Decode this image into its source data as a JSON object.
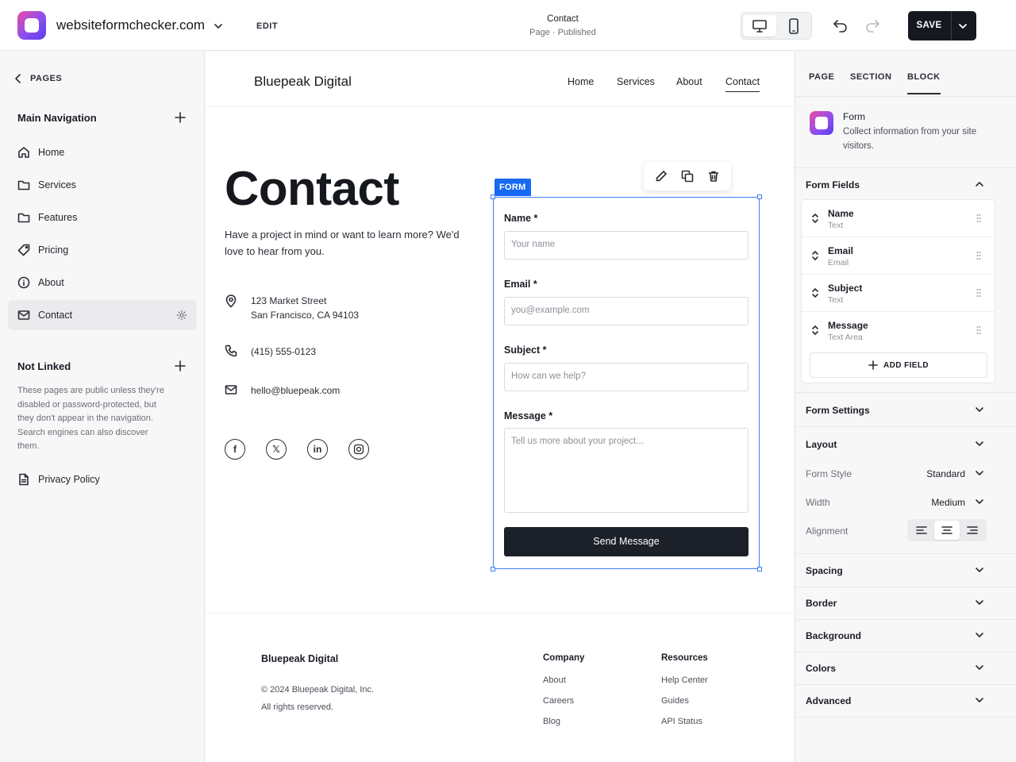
{
  "topbar": {
    "site_name": "websiteformchecker.com",
    "edit_label": "EDIT",
    "page_title": "Contact",
    "page_status": "Page · Published",
    "save_label": "SAVE",
    "active_device": "desktop"
  },
  "sidebar": {
    "back_label": "PAGES",
    "main_nav_title": "Main Navigation",
    "main_nav_items": [
      {
        "label": "Home",
        "icon": "home-icon"
      },
      {
        "label": "Services",
        "icon": "folder-icon"
      },
      {
        "label": "Features",
        "icon": "folder-icon"
      },
      {
        "label": "Pricing",
        "icon": "tag-icon"
      },
      {
        "label": "About",
        "icon": "info-icon"
      },
      {
        "label": "Contact",
        "icon": "mail-icon",
        "active": true
      }
    ],
    "not_linked_title": "Not Linked",
    "not_linked_note": "These pages are public unless they're disabled or password-protected, but they don't appear in the navigation. Search engines can also discover them.",
    "not_linked_items": [
      {
        "label": "Privacy Policy",
        "icon": "document-icon"
      }
    ]
  },
  "site": {
    "brand": "Bluepeak Digital",
    "nav": [
      "Home",
      "Services",
      "About",
      "Contact"
    ],
    "current_nav": "Contact",
    "hero_title": "Contact",
    "hero_text": "Have a project in mind or want to learn more? We'd love to hear from you.",
    "address_line1": "123 Market Street",
    "address_line2": "San Francisco, CA 94103",
    "phone": "(415) 555-0123",
    "email": "hello@bluepeak.com",
    "socials": [
      "facebook-icon",
      "x-icon",
      "linkedin-icon",
      "instagram-icon"
    ]
  },
  "form": {
    "tag": "FORM",
    "fields": [
      {
        "label": "Name *",
        "placeholder": "Your name"
      },
      {
        "label": "Email *",
        "placeholder": "you@example.com"
      },
      {
        "label": "Subject *",
        "placeholder": "How can we help?"
      },
      {
        "label": "Message *",
        "placeholder": "Tell us more about your project..."
      }
    ],
    "submit_label": "Send Message"
  },
  "footer": {
    "brand": "Bluepeak Digital",
    "copyright": "© 2024 Bluepeak Digital, Inc.",
    "rights": "All rights reserved.",
    "company_title": "Company",
    "company_links": [
      "About",
      "Careers",
      "Blog"
    ],
    "resources_title": "Resources",
    "resources_links": [
      "Help Center",
      "Guides",
      "API Status"
    ]
  },
  "panel": {
    "tabs": [
      "PAGE",
      "SECTION",
      "BLOCK"
    ],
    "active_tab": "BLOCK",
    "block_name": "Form",
    "block_desc": "Collect information from your site visitors.",
    "form_fields_title": "Form Fields",
    "form_fields": [
      {
        "name": "Name",
        "type": "Text"
      },
      {
        "name": "Email",
        "type": "Email"
      },
      {
        "name": "Subject",
        "type": "Text"
      },
      {
        "name": "Message",
        "type": "Text Area"
      }
    ],
    "add_field_label": "ADD FIELD",
    "form_settings_title": "Form Settings",
    "layout_title": "Layout",
    "form_style_label": "Form Style",
    "form_style_value": "Standard",
    "width_label": "Width",
    "width_value": "Medium",
    "alignment_label": "Alignment",
    "alignment_value": "center",
    "sections": [
      "Spacing",
      "Border",
      "Background",
      "Colors",
      "Advanced"
    ]
  },
  "colors": {
    "accent_blue": "#1769f2",
    "dark_button": "#1c2029",
    "logo_gradient_start": "#ec4ba6",
    "logo_gradient_end": "#5b3cf0"
  }
}
